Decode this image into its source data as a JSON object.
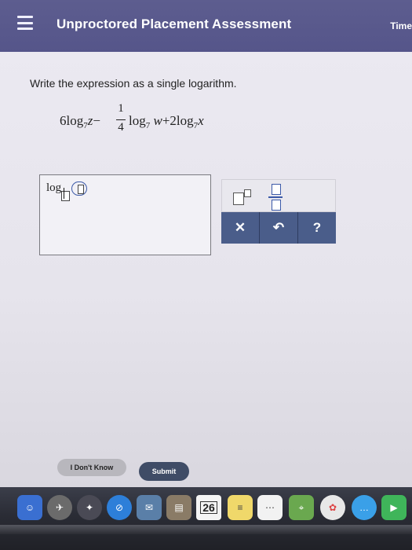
{
  "header": {
    "title": "Unproctored Placement Assessment",
    "timer_label": "Time"
  },
  "question": {
    "prompt": "Write the expression as a single logarithm.",
    "expression": {
      "term1_coef": "6log",
      "base": "7",
      "term1_var": "z",
      "minus": "−",
      "frac_num": "1",
      "frac_den": "4",
      "term2_log": "log",
      "term2_var": "w",
      "plus": "+",
      "term3_coef": "2log",
      "term3_var": "x"
    }
  },
  "answer": {
    "prefix": "log"
  },
  "palette": {
    "clear_label": "✕",
    "undo_label": "↶",
    "help_label": "?"
  },
  "buttons": {
    "dont_know": "I Don't Know",
    "submit": "Submit"
  },
  "dock": {
    "calendar_day": "26"
  }
}
